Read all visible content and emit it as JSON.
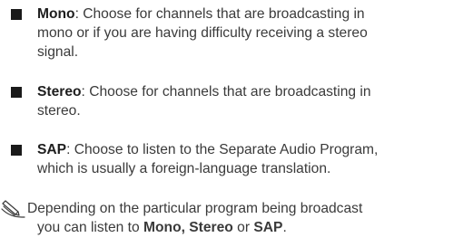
{
  "items": [
    {
      "term": "Mono",
      "lines": [
        ": Choose for channels that are broadcasting in",
        "mono or if you are having difficulty receiving a stereo",
        "signal."
      ]
    },
    {
      "term": "Stereo",
      "lines": [
        ": Choose for channels that are broadcasting in",
        "stereo."
      ]
    },
    {
      "term": "SAP",
      "lines": [
        ": Choose to listen to the Separate Audio Program,",
        "which is usually a foreign-language translation."
      ]
    }
  ],
  "note": {
    "icon": "pencil-note-icon",
    "line1": "Depending on the particular program being broadcast",
    "line2_prefix": "you can listen to ",
    "opt1": "Mono,",
    "sep1": " ",
    "opt2": "Stereo",
    "sep2": " or ",
    "opt3": "SAP",
    "end": "."
  }
}
